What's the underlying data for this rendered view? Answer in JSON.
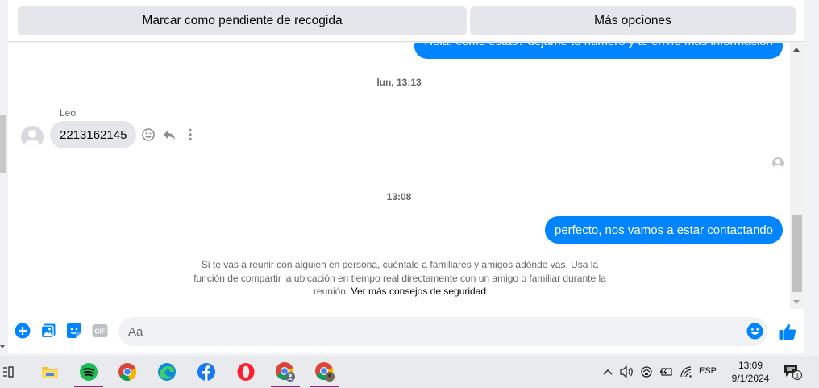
{
  "topbar": {
    "mark_pending": "Marcar como pendiente de recogida",
    "more_options": "Más opciones"
  },
  "chat": {
    "prev_outgoing": "Hola, cómo estás? déjame tu número y te envío más información",
    "timestamp_1": "lun, 13:13",
    "sender_name": "Leo",
    "incoming_message": "2213162145",
    "timestamp_2": "13:08",
    "outgoing_message": "perfecto, nos vamos a estar contactando",
    "safety_text": "Si te vas a reunir con alguien en persona, cuéntale a familiares y amigos adónde vas. Usa la función de compartir la ubicación en tiempo real directamente con un amigo o familiar durante la reunión.",
    "safety_link": "Ver más consejos de seguridad"
  },
  "composer": {
    "placeholder": "Aa",
    "gif_label": "GIF"
  },
  "taskbar": {
    "time": "13:09",
    "date": "9/1/2024",
    "language": "ESP",
    "notification_count": "1"
  },
  "colors": {
    "messenger_blue": "#0084ff",
    "bubble_gray": "#e4e6eb",
    "taskbar_bg": "#e9eaee"
  }
}
